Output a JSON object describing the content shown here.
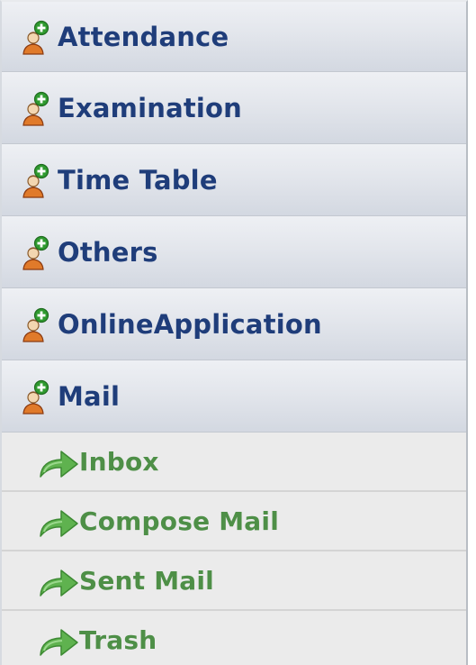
{
  "menu": {
    "sections": [
      {
        "label": "Attendance",
        "icon": "user-add-icon"
      },
      {
        "label": "Examination",
        "icon": "user-add-icon"
      },
      {
        "label": "Time Table",
        "icon": "user-add-icon"
      },
      {
        "label": "Others",
        "icon": "user-add-icon"
      },
      {
        "label": "OnlineApplication",
        "icon": "user-add-icon"
      },
      {
        "label": "Mail",
        "icon": "user-add-icon"
      }
    ],
    "mail_items": [
      {
        "label": "Inbox",
        "icon": "green-arrow-icon"
      },
      {
        "label": "Compose Mail",
        "icon": "green-arrow-icon"
      },
      {
        "label": "Sent Mail",
        "icon": "green-arrow-icon"
      },
      {
        "label": "Trash",
        "icon": "green-arrow-icon"
      }
    ]
  },
  "colors": {
    "section_text": "#1f3d7a",
    "sub_item_text": "#4e8f47",
    "section_bg": "#dde1e8",
    "sub_item_bg": "#ebebeb"
  }
}
